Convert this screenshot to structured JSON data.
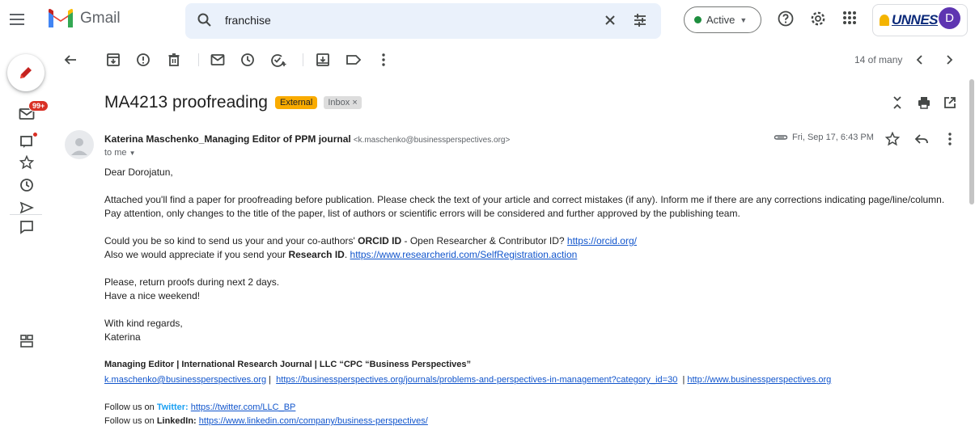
{
  "app": {
    "name": "Gmail"
  },
  "search": {
    "query": "franchise"
  },
  "status": {
    "label": "Active"
  },
  "account": {
    "org": "UNNES",
    "avatar_letter": "D"
  },
  "sidebar": {
    "badge": "99+"
  },
  "toolbar": {
    "pager": "14 of many"
  },
  "email": {
    "subject": "MA4213 proofreading",
    "labels": {
      "external": "External",
      "inbox": "Inbox"
    },
    "sender_name": "Katerina Maschenko_Managing Editor of PPM journal",
    "sender_email": "<k.maschenko@businessperspectives.org>",
    "to": "to me",
    "date": "Fri, Sep 17, 6:43 PM",
    "greeting": "Dear Dorojatun,",
    "p1_line1": "Attached you'll find a paper for proofreading before publication. Please check the text of your article and correct mistakes (if any). Inform me if there are any corrections indicating page/line/column.",
    "p1_line2": "Pay attention, only changes to the title of the paper, list of authors or scientific errors will be considered and further approved by the publishing team.",
    "p2_a_pre": "Could you be so kind to send us your and your co-authors' ",
    "p2_a_bold": "ORCID ID",
    "p2_a_post": " - Open Researcher & Contributor ID? ",
    "p2_a_link": "https://orcid.org/",
    "p2_b_pre": "Also we would appreciate if you send your ",
    "p2_b_bold": "Research ID",
    "p2_b_post": ". ",
    "p2_b_link": "https://www.researcherid.com/SelfRegistration.action",
    "p3_line1": "Please, return proofs during next 2 days.",
    "p3_line2": "Have a nice weekend!",
    "closing1": "With kind regards,",
    "closing2": "Katerina",
    "sig_title": "Managing Editor | International Research Journal | LLC “CPC “Business Perspectives”",
    "sig_link1": "k.maschenko@businessperspectives.org",
    "sig_link2": "https://businessperspectives.org/journals/problems-and-perspectives-in-management?category_id=30",
    "sig_link3": "http://www.businessperspectives.org",
    "follow_pre": "Follow us on ",
    "twitter_label": "Twitter:",
    "twitter_link": "https://twitter.com/LLC_BP",
    "linkedin_label": "LinkedIn:",
    "linkedin_link": "https://www.linkedin.com/company/business-perspectives/"
  }
}
